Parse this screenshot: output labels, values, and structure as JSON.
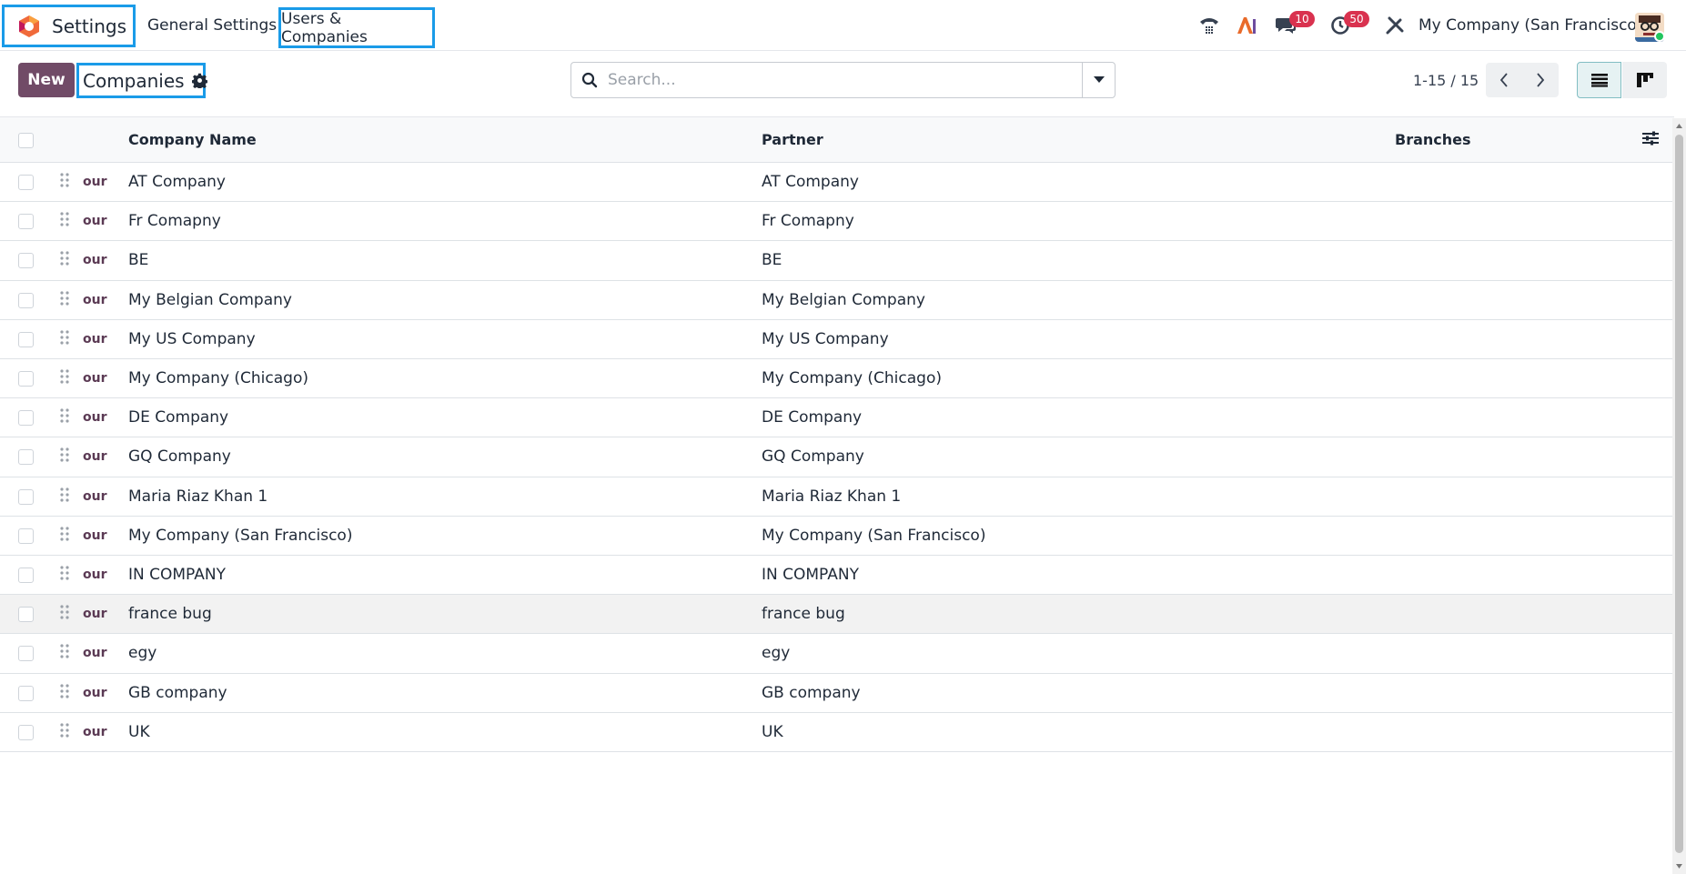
{
  "navbar": {
    "app_title": "Settings",
    "menu_general": "General Settings",
    "menu_users": "Users & Companies",
    "messages_badge": "10",
    "activities_badge": "50",
    "company_switcher": "My Company (San Francisco)"
  },
  "control": {
    "new_label": "New",
    "breadcrumb": "Companies",
    "search_placeholder": "Search...",
    "pager": "1-15 / 15"
  },
  "table": {
    "headers": {
      "name": "Company Name",
      "partner": "Partner",
      "branches": "Branches"
    },
    "rows": [
      {
        "seq": "our",
        "name": "AT Company",
        "partner": "AT Company"
      },
      {
        "seq": "our",
        "name": "Fr Comapny",
        "partner": "Fr Comapny"
      },
      {
        "seq": "our",
        "name": "BE",
        "partner": "BE"
      },
      {
        "seq": "our",
        "name": "My Belgian Company",
        "partner": "My Belgian Company"
      },
      {
        "seq": "our",
        "name": "My US Company",
        "partner": "My US Company"
      },
      {
        "seq": "our",
        "name": "My Company (Chicago)",
        "partner": "My Company (Chicago)"
      },
      {
        "seq": "our",
        "name": "DE Company",
        "partner": "DE Company"
      },
      {
        "seq": "our",
        "name": "GQ Company",
        "partner": "GQ Company"
      },
      {
        "seq": "our",
        "name": "Maria Riaz Khan 1",
        "partner": "Maria Riaz Khan 1"
      },
      {
        "seq": "our",
        "name": "My Company (San Francisco)",
        "partner": "My Company (San Francisco)"
      },
      {
        "seq": "our",
        "name": "IN COMPANY",
        "partner": "IN COMPANY"
      },
      {
        "seq": "our",
        "name": "france bug",
        "partner": "france bug"
      },
      {
        "seq": "our",
        "name": "egy",
        "partner": "egy"
      },
      {
        "seq": "our",
        "name": "GB company",
        "partner": "GB company"
      },
      {
        "seq": "our",
        "name": "UK",
        "partner": "UK"
      }
    ]
  },
  "colors": {
    "accent": "#714b67",
    "highlight_border": "#1a9be8",
    "badge": "#d9324f"
  }
}
